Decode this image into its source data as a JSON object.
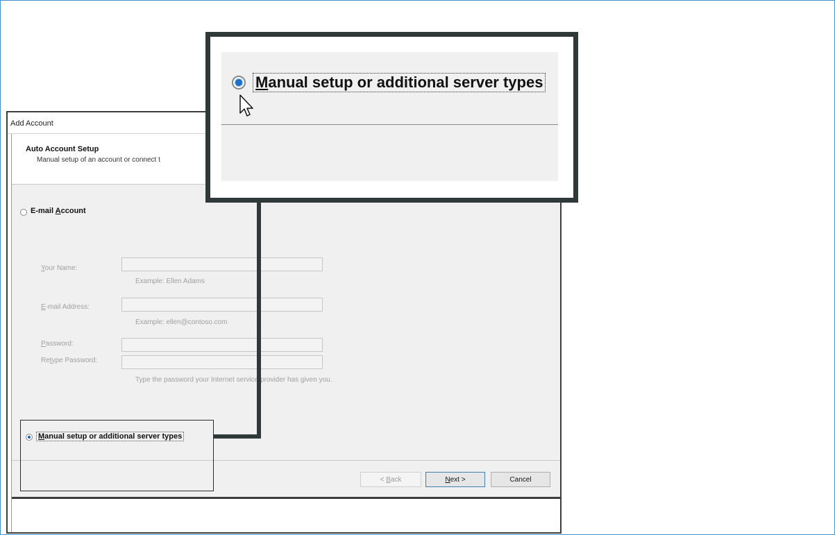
{
  "dialog": {
    "title": "Add Account",
    "header_title": "Auto Account Setup",
    "header_subtitle": "Manual setup of an account or connect t",
    "email_option": {
      "prefix": "E-mail ",
      "accel": "A",
      "suffix": "ccount"
    },
    "fields": {
      "name": {
        "accel": "Y",
        "rest": "our Name:",
        "example": "Example: Ellen Adams"
      },
      "email": {
        "accel": "E",
        "rest": "-mail Address:",
        "example": "Example: ellen@contoso.com"
      },
      "password": {
        "accel": "P",
        "rest": "assword:"
      },
      "retype": {
        "prefix": "Re",
        "accel": "t",
        "rest": "ype Password:"
      },
      "password_hint": "Type the password your Internet service provider has given you."
    },
    "manual_option": {
      "accel": "M",
      "rest": "anual setup or additional server types"
    },
    "buttons": {
      "back": {
        "prefix": "< ",
        "accel": "B",
        "rest": "ack"
      },
      "next": {
        "accel": "N",
        "rest": "ext >"
      },
      "cancel": "Cancel"
    }
  },
  "zoom": {
    "label": {
      "accel": "M",
      "rest": "anual setup or additional server types"
    }
  },
  "colors": {
    "callout_border": "#2f3a38",
    "radio_selected": "#1f6fc5",
    "frame": "#4a90c8"
  },
  "icons": [
    "radio-selected-icon",
    "radio-unselected-icon",
    "mouse-cursor-icon"
  ]
}
